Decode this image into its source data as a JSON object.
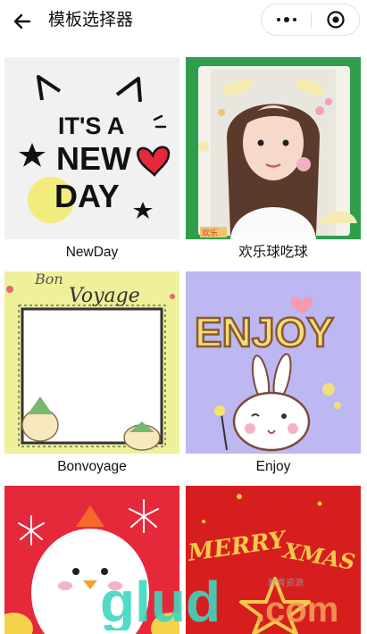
{
  "header": {
    "title": "模板选择器",
    "back_icon": "arrow-left-icon",
    "more_icon": "more-dots-icon",
    "close_icon": "target-circle-icon"
  },
  "templates": [
    {
      "label": "NewDay",
      "art_text": [
        "IT'S A",
        "NEW",
        "DAY"
      ]
    },
    {
      "label": "欢乐球吃球",
      "art_text": [
        "欢乐"
      ]
    },
    {
      "label": "Bonvoyage",
      "art_text": [
        "Bon",
        "Voyage"
      ]
    },
    {
      "label": "Enjoy",
      "art_text": [
        "ENJOY"
      ]
    },
    {
      "label": "",
      "art_text": []
    },
    {
      "label": "",
      "art_text": [
        "MERRY",
        "XMAS"
      ]
    }
  ],
  "watermark": {
    "text": "glud",
    "suffix": ".com",
    "small": "教育资源"
  },
  "colors": {
    "accent_green": "#2e9e4d",
    "red": "#e5293a",
    "purple_bg": "#bdb7f2",
    "yellow": "#f3e25e",
    "watermark_teal": "#3fd6c0",
    "watermark_orange": "#f5a35a"
  }
}
